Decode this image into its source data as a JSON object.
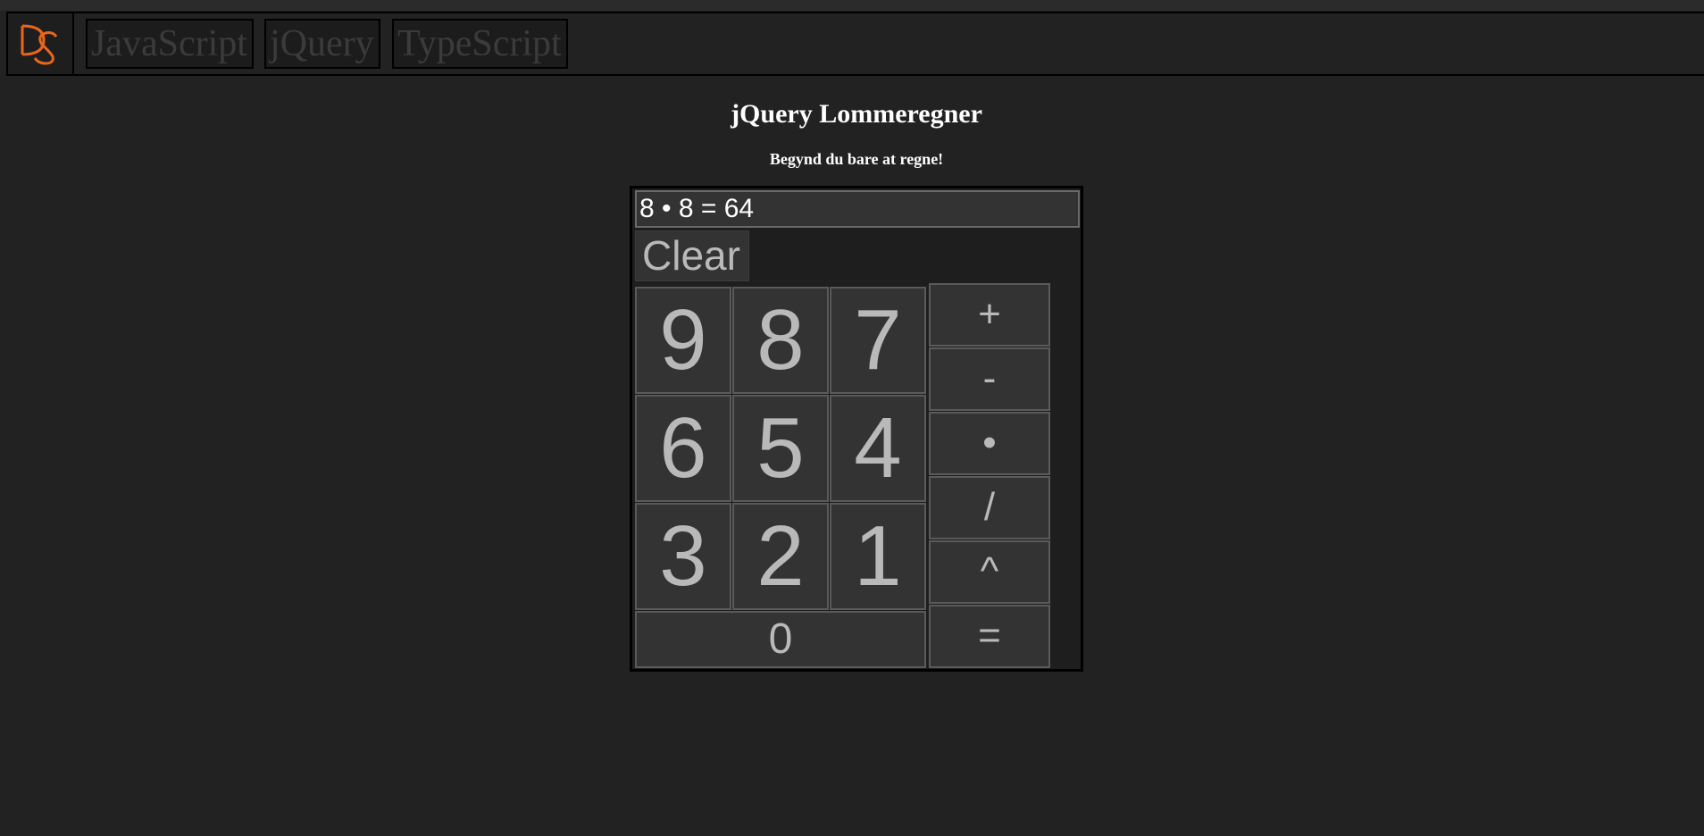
{
  "nav": {
    "logo_text": "DS",
    "links": [
      "JavaScript",
      "jQuery",
      "TypeScript"
    ]
  },
  "page": {
    "title": "jQuery Lommeregner",
    "subtitle": "Begynd du bare at regne!"
  },
  "calculator": {
    "display": "8 • 8 = 64",
    "clear_label": "Clear",
    "digits": [
      "9",
      "8",
      "7",
      "6",
      "5",
      "4",
      "3",
      "2",
      "1"
    ],
    "zero": "0",
    "operators": [
      "+",
      "-",
      "•",
      "/",
      "^",
      "="
    ]
  },
  "colors": {
    "background": "#222222",
    "key_background": "#333333",
    "key_text": "#b9b9b9",
    "logo_accent": "#e8661c"
  }
}
